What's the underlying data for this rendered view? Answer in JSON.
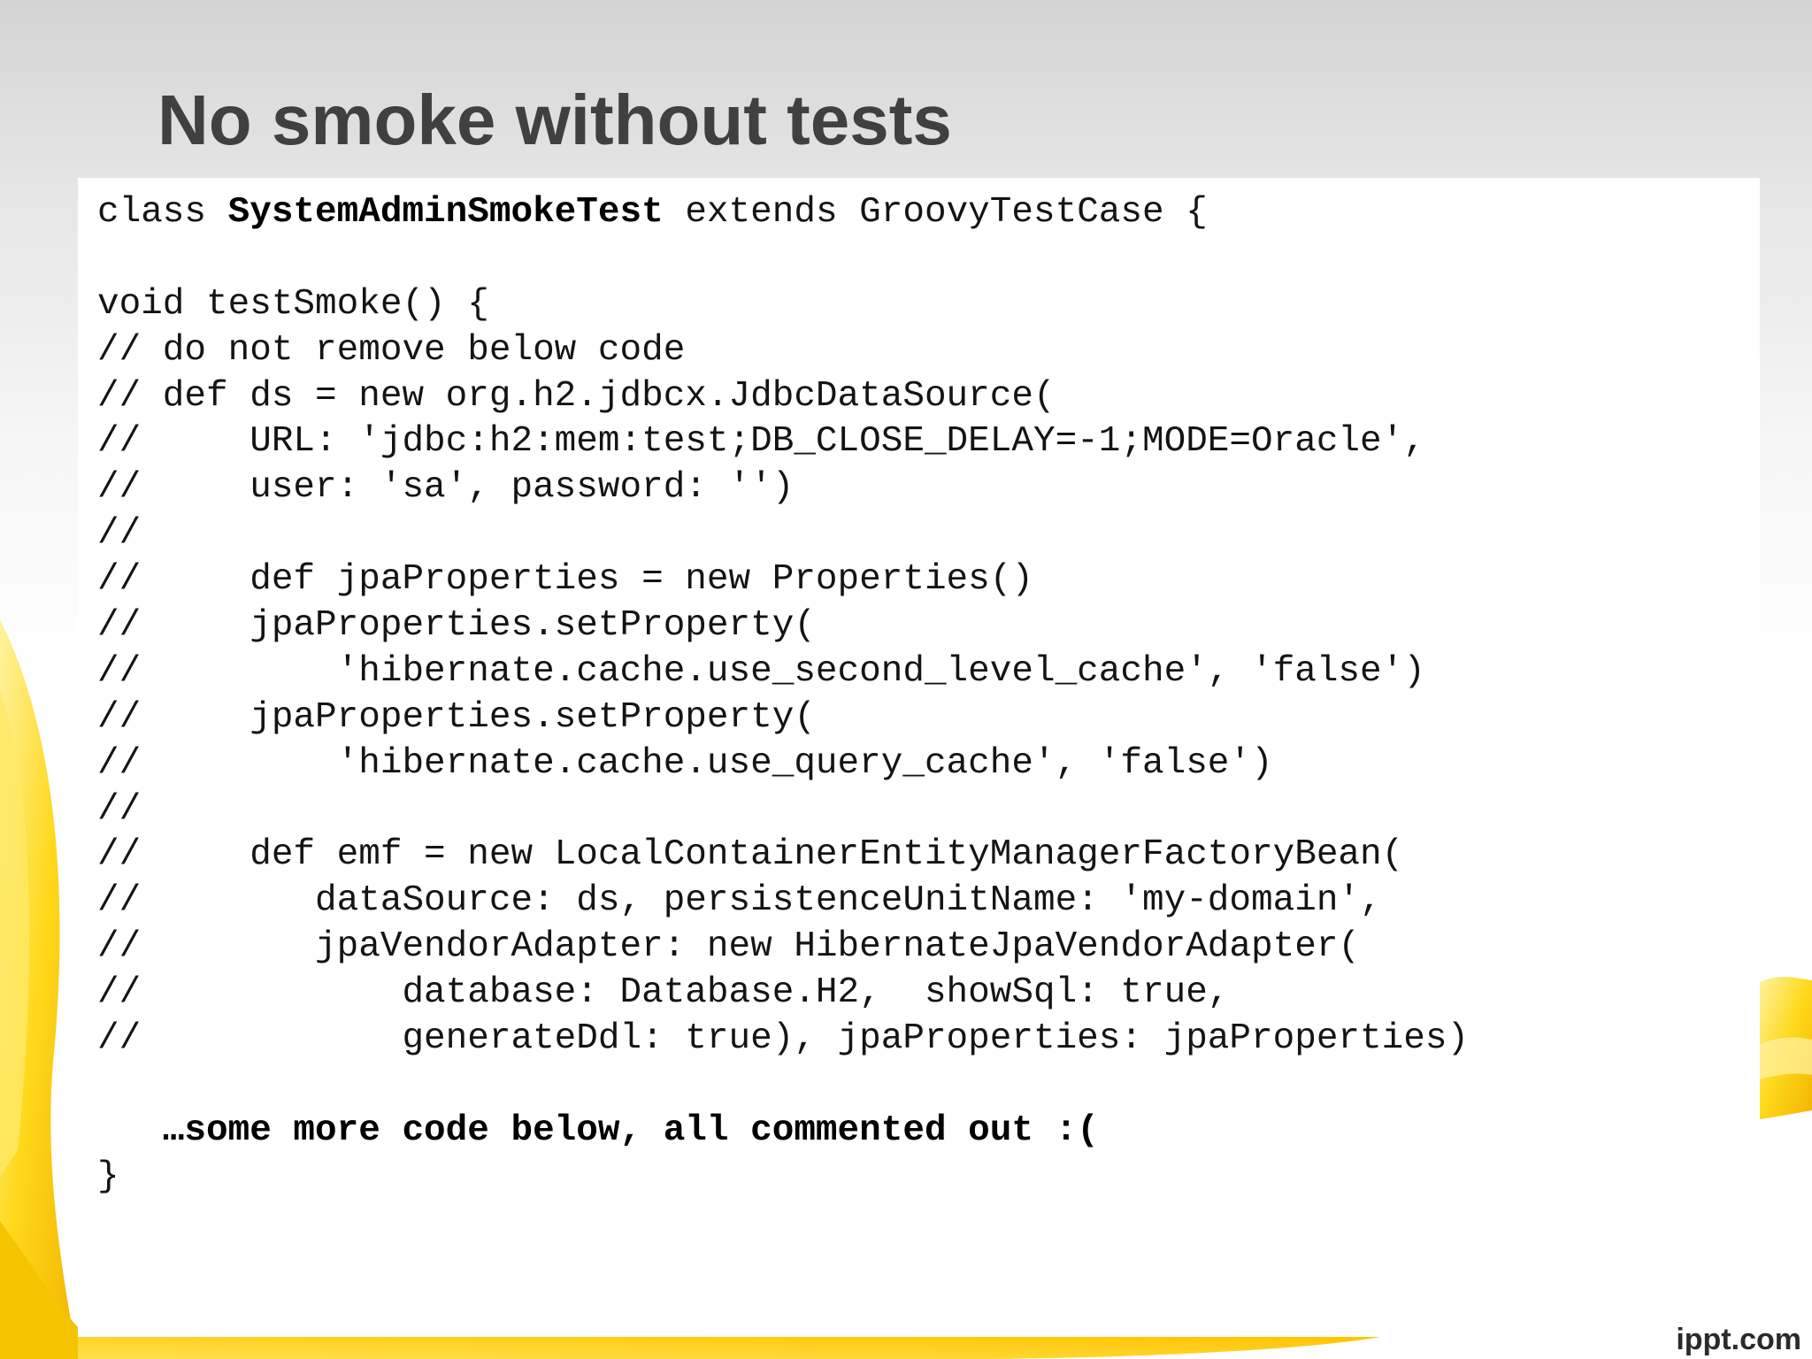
{
  "slide": {
    "title": "No smoke without tests"
  },
  "code": {
    "class_keyword": "class ",
    "class_name": "SystemAdminSmokeTest",
    "class_rest": " extends GroovyTestCase {",
    "lines": [
      "",
      "void testSmoke() {",
      "// do not remove below code",
      "// def ds = new org.h2.jdbcx.JdbcDataSource(",
      "//     URL: 'jdbc:h2:mem:test;DB_CLOSE_DELAY=-1;MODE=Oracle',",
      "//     user: 'sa', password: '')",
      "//",
      "//     def jpaProperties = new Properties()",
      "//     jpaProperties.setProperty(",
      "//         'hibernate.cache.use_second_level_cache', 'false')",
      "//     jpaProperties.setProperty(",
      "//         'hibernate.cache.use_query_cache', 'false')",
      "//",
      "//     def emf = new LocalContainerEntityManagerFactoryBean(",
      "//        dataSource: ds, persistenceUnitName: 'my-domain',",
      "//        jpaVendorAdapter: new HibernateJpaVendorAdapter(",
      "//            database: Database.H2,  showSql: true,",
      "//            generateDdl: true), jpaProperties: jpaProperties)",
      ""
    ],
    "note": "   …some more code below, all commented out :(",
    "closing": "}"
  },
  "watermark": "ippt.com"
}
